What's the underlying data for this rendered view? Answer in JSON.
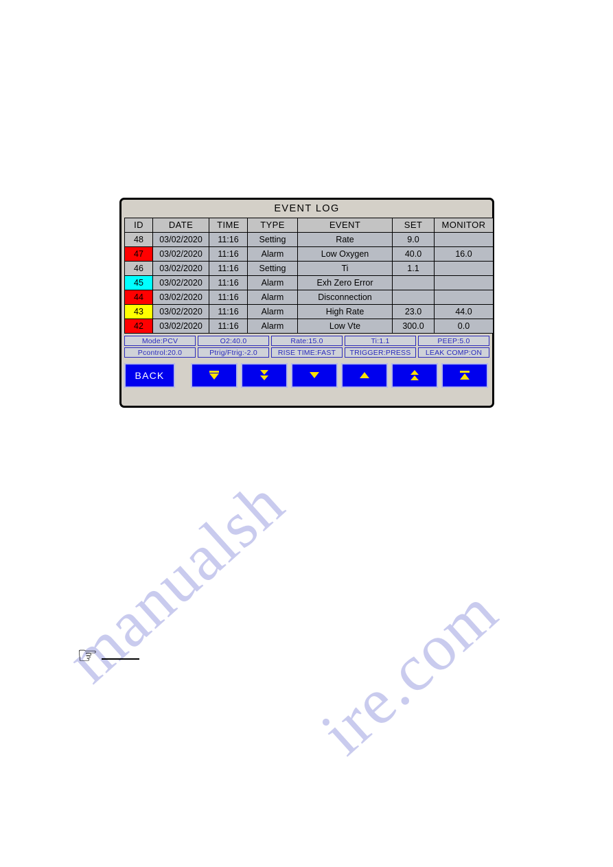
{
  "watermark": {
    "line1": "manualsh",
    "line2": "ire.com"
  },
  "panel": {
    "title": "EVENT LOG",
    "table": {
      "columns": [
        "ID",
        "DATE",
        "TIME",
        "TYPE",
        "EVENT",
        "SET",
        "MONITOR"
      ],
      "rows": [
        {
          "id": "48",
          "id_color": "none",
          "date": "03/02/2020",
          "time": "11:16",
          "type": "Setting",
          "event": "Rate",
          "set": "9.0",
          "monitor": ""
        },
        {
          "id": "47",
          "id_color": "red",
          "date": "03/02/2020",
          "time": "11:16",
          "type": "Alarm",
          "event": "Low Oxygen",
          "set": "40.0",
          "monitor": "16.0"
        },
        {
          "id": "46",
          "id_color": "none",
          "date": "03/02/2020",
          "time": "11:16",
          "type": "Setting",
          "event": "Ti",
          "set": "1.1",
          "monitor": ""
        },
        {
          "id": "45",
          "id_color": "cyan",
          "date": "03/02/2020",
          "time": "11:16",
          "type": "Alarm",
          "event": "Exh Zero Error",
          "set": "",
          "monitor": ""
        },
        {
          "id": "44",
          "id_color": "red",
          "date": "03/02/2020",
          "time": "11:16",
          "type": "Alarm",
          "event": "Disconnection",
          "set": "",
          "monitor": ""
        },
        {
          "id": "43",
          "id_color": "yellow",
          "date": "03/02/2020",
          "time": "11:16",
          "type": "Alarm",
          "event": "High Rate",
          "set": "23.0",
          "monitor": "44.0"
        },
        {
          "id": "42",
          "id_color": "red",
          "date": "03/02/2020",
          "time": "11:16",
          "type": "Alarm",
          "event": "Low Vte",
          "set": "300.0",
          "monitor": "0.0"
        }
      ]
    },
    "parameters": {
      "row1": [
        "Mode:PCV",
        "O2:40.0",
        "Rate:15.0",
        "Ti:1.1",
        "PEEP:5.0"
      ],
      "row2": [
        "Pcontrol:20.0",
        "Ptrig/Ftrig:-2.0",
        "RISE TIME:FAST",
        "TRIGGER:PRESS",
        "LEAK COMP:ON"
      ]
    },
    "buttons": {
      "back_label": "BACK",
      "nav": [
        {
          "name": "page-last-button",
          "icon": "bar-over-down-triangle-icon"
        },
        {
          "name": "page-down-button",
          "icon": "double-down-triangle-icon"
        },
        {
          "name": "scroll-down-button",
          "icon": "down-triangle-icon"
        },
        {
          "name": "scroll-up-button",
          "icon": "up-triangle-icon"
        },
        {
          "name": "page-up-button",
          "icon": "double-up-triangle-icon"
        },
        {
          "name": "page-first-button",
          "icon": "bar-over-up-triangle-icon"
        }
      ]
    },
    "colors": {
      "panel_bg": "#d4d0c8",
      "table_bg": "#b8bcc4",
      "header_bg": "#c3c3c3",
      "alarm_red": "#ff0000",
      "alarm_yellow": "#ffff00",
      "alarm_cyan": "#00ffff",
      "button_blue": "#0000ee",
      "param_text": "#2b2bbb",
      "arrow_yellow": "#ffe000"
    }
  },
  "note": {
    "hand_icon": "pointing-hand-icon"
  }
}
